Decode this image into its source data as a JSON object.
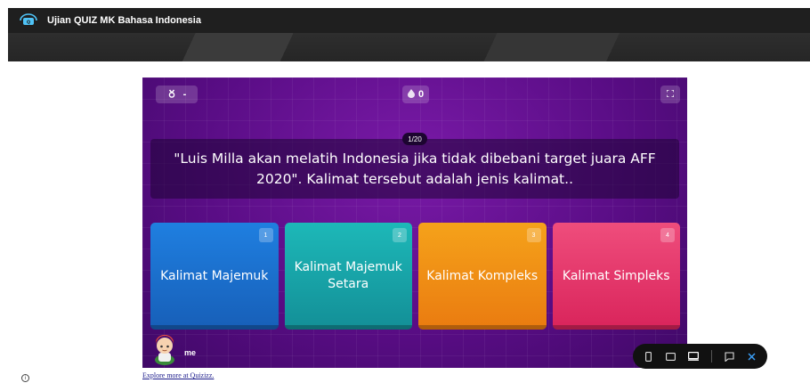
{
  "header": {
    "title": "Ujian QUIZ MK Bahasa Indonesia",
    "logo_icon": "quizizz-logo-icon"
  },
  "quiz": {
    "powerups": {
      "icon": "powerup-icon",
      "value": "-"
    },
    "streak": {
      "icon": "fire-icon",
      "value": "0"
    },
    "fullscreen_icon": "fullscreen-icon",
    "counter": "1/20",
    "question": "\"Luis Milla akan melatih Indonesia jika tidak dibebani target juara AFF 2020\". Kalimat tersebut adalah jenis kalimat..",
    "answers": [
      {
        "number": "1",
        "label": "Kalimat Majemuk",
        "color": "#1f7fe0"
      },
      {
        "number": "2",
        "label": "Kalimat Majemuk Setara",
        "color": "#1db8b8"
      },
      {
        "number": "3",
        "label": "Kalimat Kompleks",
        "color": "#f5a21a"
      },
      {
        "number": "4",
        "label": "Kalimat Simpleks",
        "color": "#ef4d7c"
      }
    ],
    "player": {
      "name": "me",
      "avatar_icon": "player-avatar"
    }
  },
  "device_toolbar": {
    "icons": [
      "mobile-icon",
      "tablet-icon",
      "desktop-icon",
      "feedback-icon",
      "close-icon"
    ],
    "active": "desktop-icon"
  },
  "footer": {
    "explore_link": "Explore more at Quizizz.",
    "info_icon": "info-icon"
  }
}
